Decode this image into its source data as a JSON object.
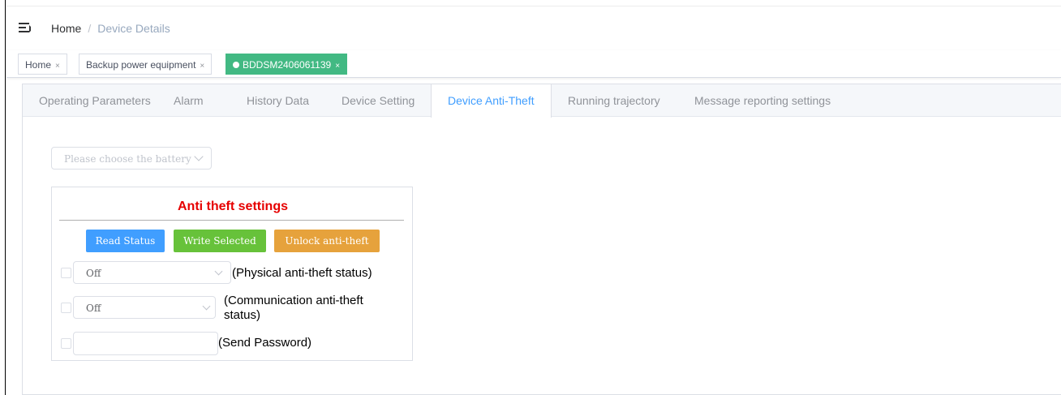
{
  "breadcrumb": {
    "home": "Home",
    "separator": "/",
    "current": "Device Details"
  },
  "tags": [
    {
      "label": "Home",
      "close": "×",
      "active": false
    },
    {
      "label": "Backup power equipment",
      "close": "×",
      "active": false
    },
    {
      "label": "BDDSM2406061139",
      "close": "×",
      "active": true
    }
  ],
  "tabs": [
    {
      "label": "Operating Parameters",
      "active": false
    },
    {
      "label": "Alarm",
      "active": false
    },
    {
      "label": "History Data",
      "active": false
    },
    {
      "label": "Device Setting",
      "active": false
    },
    {
      "label": "Device Anti-Theft",
      "active": true
    },
    {
      "label": "Running trajectory",
      "active": false
    },
    {
      "label": "Message reporting settings",
      "active": false
    }
  ],
  "battery_select": {
    "placeholder": "Please choose the battery"
  },
  "panel": {
    "title": "Anti theft settings",
    "buttons": {
      "read": "Read Status",
      "write": "Write Selected",
      "unlock": "Unlock anti-theft"
    },
    "rows": [
      {
        "value": "Off",
        "label": "(Physical anti-theft status)",
        "checked": false
      },
      {
        "value": "Off",
        "label": "(Communication anti-theft status)",
        "checked": false
      },
      {
        "value": "",
        "label": "(Send Password)",
        "checked": false
      }
    ]
  },
  "colors": {
    "accent": "#409eff",
    "active_tag": "#42b983",
    "title_red": "#e60000",
    "button_blue": "#409eff",
    "button_green": "#67c23a",
    "button_orange": "#e6a23c"
  },
  "icons": {
    "menu": "menu-fold-icon",
    "tag_dot": "status-dot-icon",
    "select_arrow": "chevron-down-icon"
  }
}
